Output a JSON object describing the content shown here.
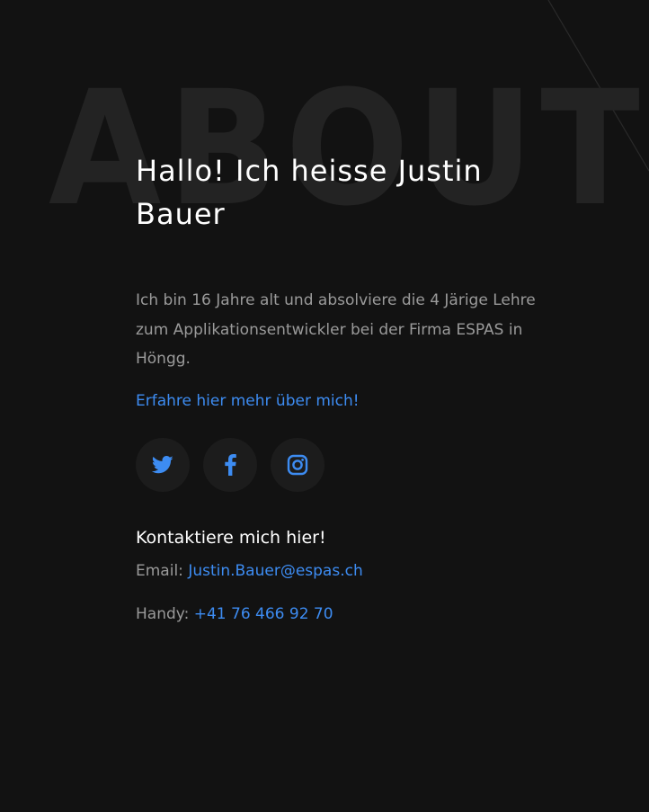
{
  "watermark": "ABOUT",
  "about": {
    "heading": "Hallo! Ich heisse Justin Bauer",
    "bio": "Ich bin 16 Jahre alt und absolviere die 4 Järige Lehre zum Applikationsentwickler bei der Firma ESPAS in Höngg.",
    "more_link": "Erfahre hier mehr über mich!"
  },
  "social": [
    {
      "icon": "twitter-icon"
    },
    {
      "icon": "facebook-icon"
    },
    {
      "icon": "instagram-icon"
    }
  ],
  "contact": {
    "title": "Kontaktiere mich hier!",
    "email_label": "Email:",
    "email_value": "Justin.Bauer@espas.ch",
    "phone_label": "Handy:",
    "phone_value": "+41 76 466 92 70"
  },
  "colors": {
    "background": "#121212",
    "accent": "#3d8cf2",
    "muted_text": "#9a9a9a",
    "watermark": "#232323",
    "social_button_bg": "#1c1c1c"
  }
}
